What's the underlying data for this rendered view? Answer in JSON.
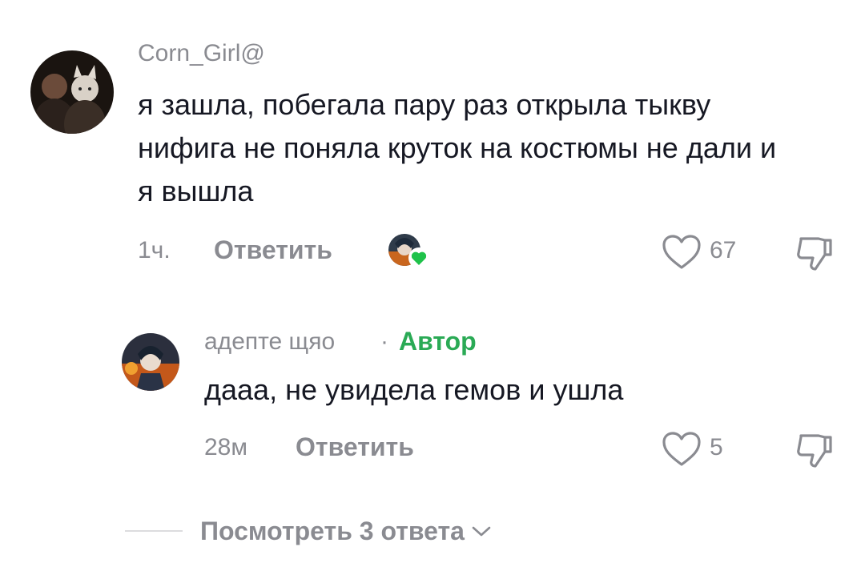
{
  "comments": [
    {
      "username": "Corn_Girl@",
      "text": "я зашла, побегала пару раз открыла тыкву нифига не поняла круток на костюмы не дали и я вышла",
      "time": "1ч.",
      "reply_label": "Ответить",
      "likes": "67"
    },
    {
      "username": "адепте щяо",
      "separator": "·",
      "author_badge": "Автор",
      "text": "дааа, не увидела гемов и ушла",
      "time": "28м",
      "reply_label": "Ответить",
      "likes": "5"
    }
  ],
  "view_replies": {
    "label": "Посмотреть 3 ответа"
  },
  "icons": {
    "like": "heart-outline-icon",
    "dislike": "thumbs-down-icon",
    "expand": "chevron-down-icon",
    "creator_liked": "green-heart-badge-icon"
  },
  "colors": {
    "text_primary": "#161823",
    "text_secondary": "#8a8b91",
    "author_badge": "#2aaa55",
    "creator_like_heart": "#1fc24a"
  }
}
